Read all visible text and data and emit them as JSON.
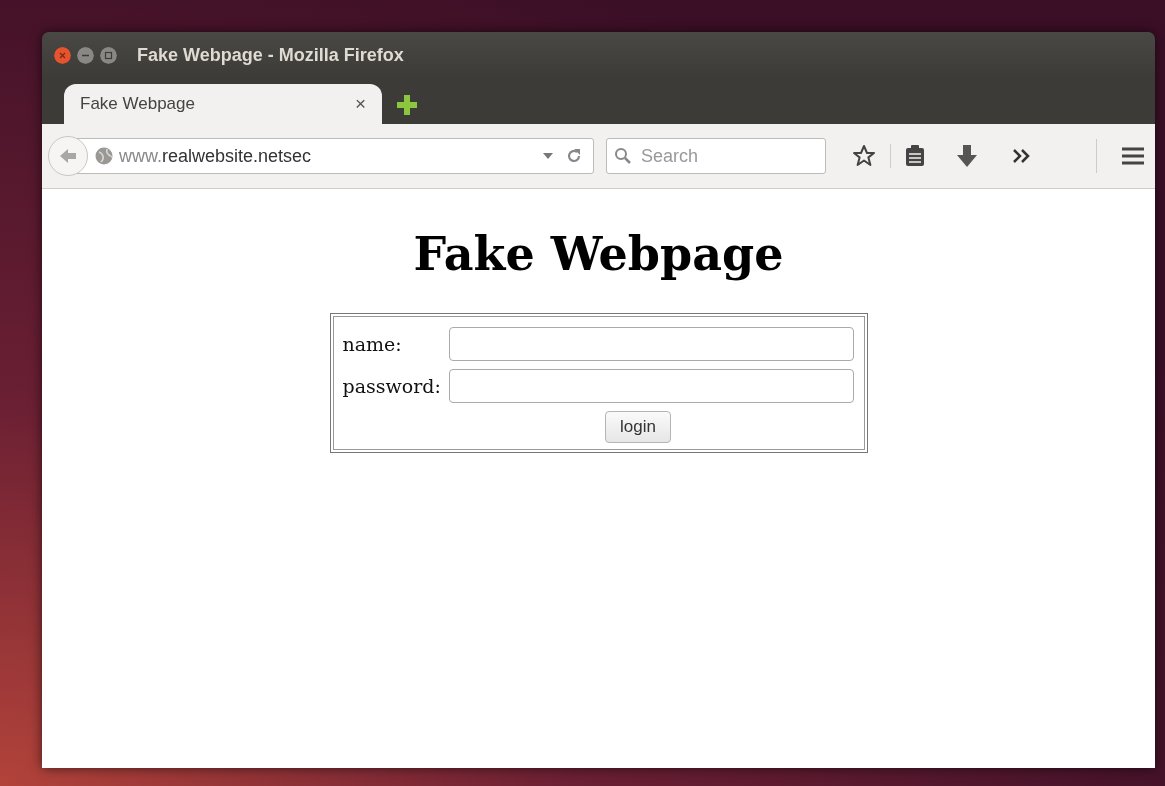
{
  "window": {
    "title": "Fake Webpage - Mozilla Firefox"
  },
  "tabs": [
    {
      "label": "Fake Webpage",
      "close": "×",
      "selected": true
    }
  ],
  "address_bar": {
    "prefix": "www.",
    "domain": "realwebsite.netsec"
  },
  "search": {
    "placeholder": "Search"
  },
  "page": {
    "heading": "Fake Webpage",
    "fields": [
      {
        "label": "name:"
      },
      {
        "label": "password:"
      }
    ],
    "button": "login"
  }
}
